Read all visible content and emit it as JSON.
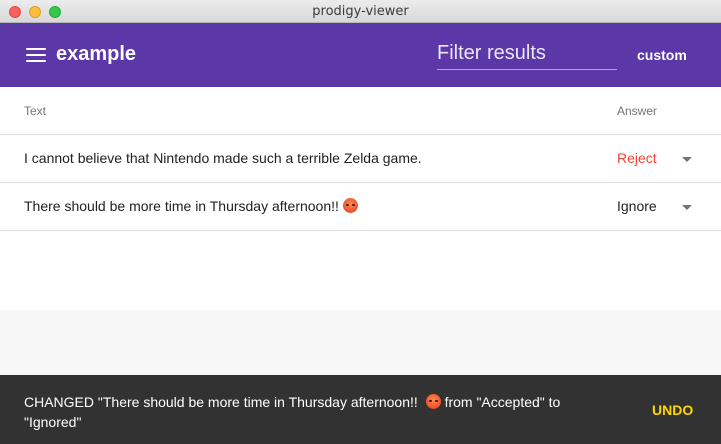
{
  "window": {
    "title": "prodigy-viewer"
  },
  "header": {
    "title": "example",
    "filter_placeholder": "Filter results",
    "custom_label": "custom"
  },
  "table": {
    "columns": {
      "text": "Text",
      "answer": "Answer"
    },
    "rows": [
      {
        "text": "I cannot believe that Nintendo made such a terrible Zelda game.",
        "answer": "Reject",
        "answer_color": "#f44336",
        "has_emoji": false
      },
      {
        "text": "There should be more time in Thursday afternoon!!",
        "answer": "Ignore",
        "answer_color": "#212121",
        "has_emoji": true
      }
    ]
  },
  "snackbar": {
    "message_prefix": "CHANGED \"There should be more time in Thursday afternoon!!",
    "message_suffix": "from \"Accepted\" to \"Ignored\"",
    "action_label": "UNDO"
  },
  "colors": {
    "header_bg": "#5b37a8",
    "reject": "#f44336",
    "snackbar_bg": "#323232",
    "undo": "#ffd600"
  }
}
